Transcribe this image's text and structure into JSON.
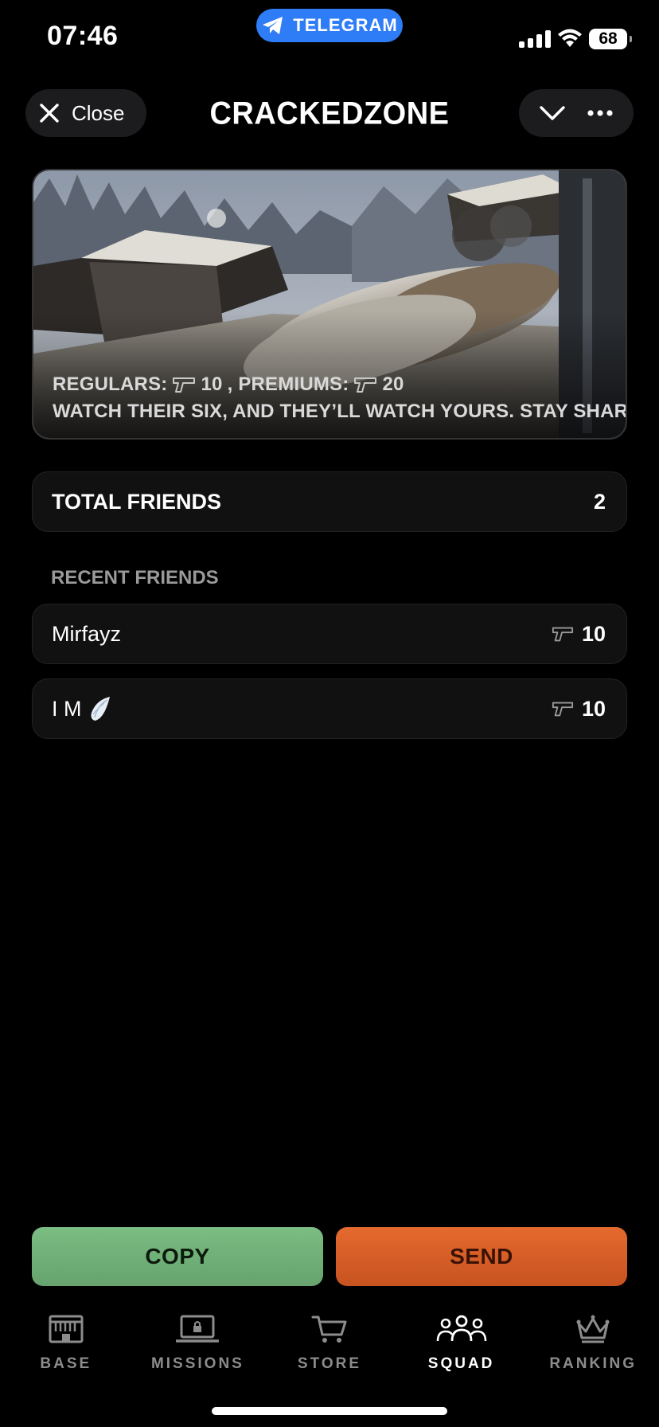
{
  "status_bar": {
    "time": "07:46",
    "telegram_label": "TELEGRAM",
    "battery": "68",
    "icons": [
      "signal-icon",
      "wifi-icon",
      "battery-icon"
    ]
  },
  "header": {
    "close_label": "Close",
    "title": "CRACKEDZONE",
    "icons": [
      "close-icon",
      "chevron-down-icon",
      "more-icon"
    ]
  },
  "banner": {
    "regulars_label": "REGULARS:",
    "regulars_value": "10",
    "premiums_label": ", PREMIUMS:",
    "premiums_value": "20",
    "tagline": "WATCH THEIR SIX, AND THEY’LL WATCH YOURS. STAY SHARP!"
  },
  "total_friends": {
    "label": "TOTAL FRIENDS",
    "value": "2"
  },
  "recent_friends": {
    "label": "RECENT FRIENDS",
    "items": [
      {
        "name": "Mirfayz",
        "score": "10"
      },
      {
        "name": "I M",
        "emoji": "wing",
        "score": "10"
      }
    ]
  },
  "actions": {
    "copy_label": "COPY",
    "send_label": "SEND",
    "colors": {
      "copy": "#72b07a",
      "send": "#dd6228"
    }
  },
  "nav": {
    "items": [
      {
        "label": "BASE",
        "icon": "base-icon",
        "active": false
      },
      {
        "label": "MISSIONS",
        "icon": "laptop-lock-icon",
        "active": false
      },
      {
        "label": "STORE",
        "icon": "cart-icon",
        "active": false
      },
      {
        "label": "SQUAD",
        "icon": "squad-icon",
        "active": true
      },
      {
        "label": "RANKING",
        "icon": "crown-icon",
        "active": false
      }
    ]
  },
  "colors": {
    "accent_telegram": "#2f7df6",
    "background": "#000000",
    "card": "#111112"
  }
}
